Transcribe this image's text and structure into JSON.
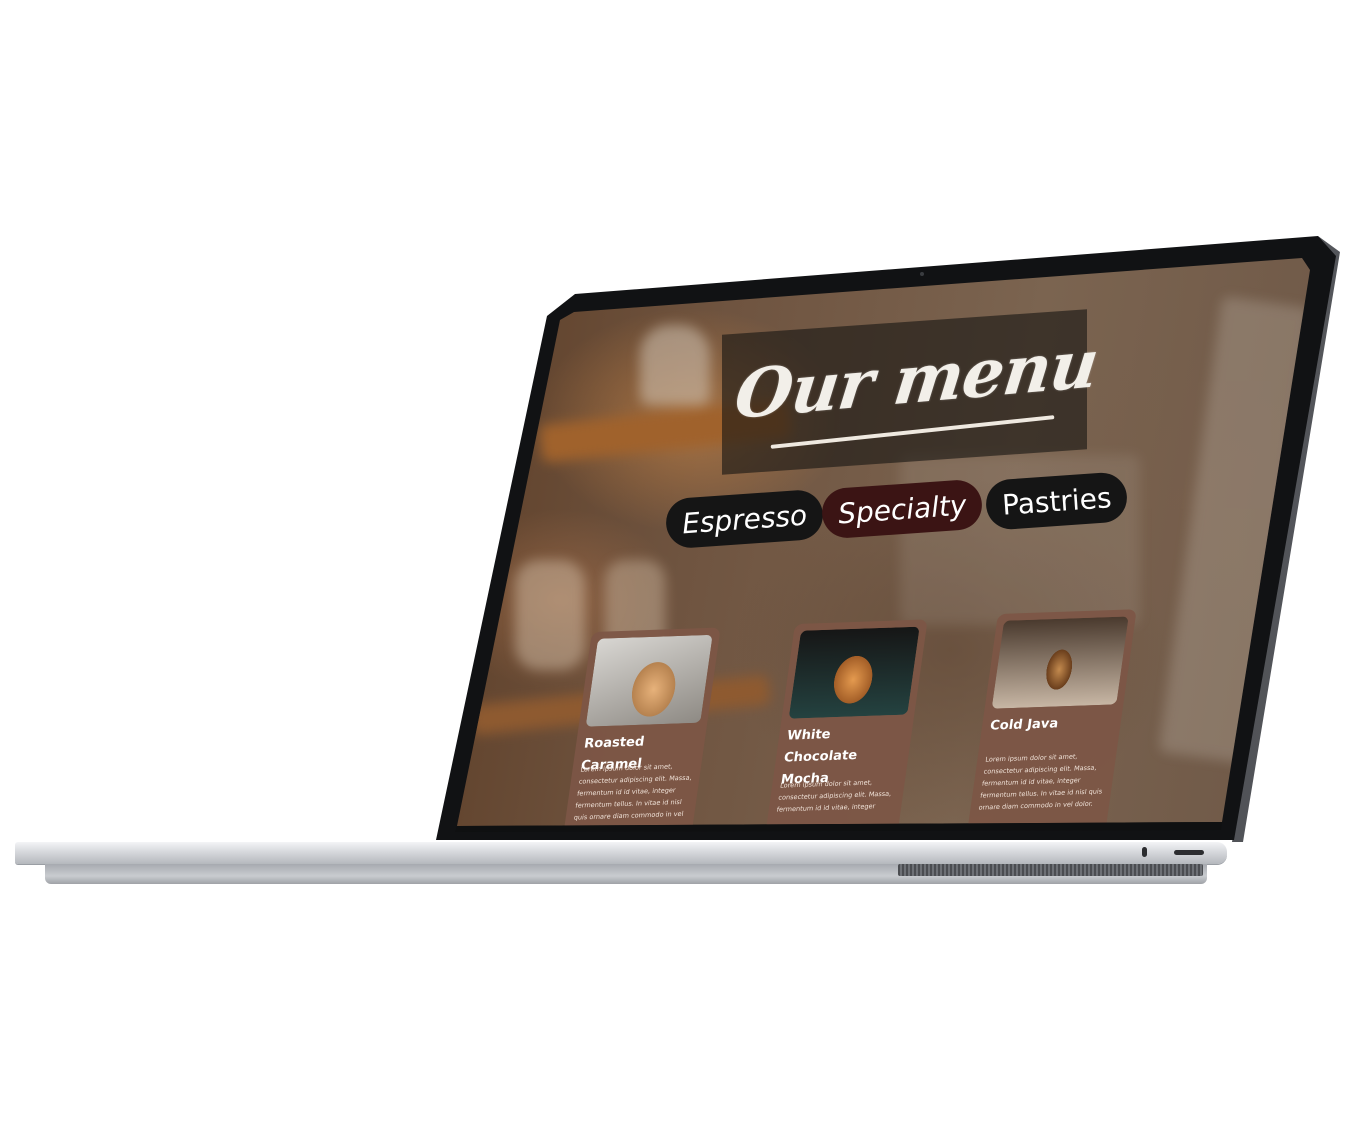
{
  "menu": {
    "title": "Our menu",
    "tabs": [
      {
        "label": "Espresso"
      },
      {
        "label": "Specialty",
        "active": true
      },
      {
        "label": "Pastries"
      }
    ],
    "items": [
      {
        "name": "Roasted Caramel",
        "description": "Lorem ipsum dolor sit amet, consectetur adipiscing elit. Massa, fermentum id id vitae, integer fermentum tellus. In vitae id nisl quis ornare diam commodo in vel dolor."
      },
      {
        "name": "White Chocolate Mocha",
        "description": "Lorem ipsum dolor sit amet, consectetur adipiscing elit. Massa, fermentum id id vitae, integer"
      },
      {
        "name": "Cold Java",
        "description": "Lorem ipsum dolor sit amet, consectetur adipiscing elit. Massa, fermentum id id vitae, integer fermentum tellus. In vitae id nisl quis ornare diam commodo in vel dolor."
      }
    ]
  },
  "colors": {
    "tab_default": "#151515",
    "tab_active": "#3b1414",
    "card_background": "#7d5646",
    "title_text": "#f2efe9"
  }
}
